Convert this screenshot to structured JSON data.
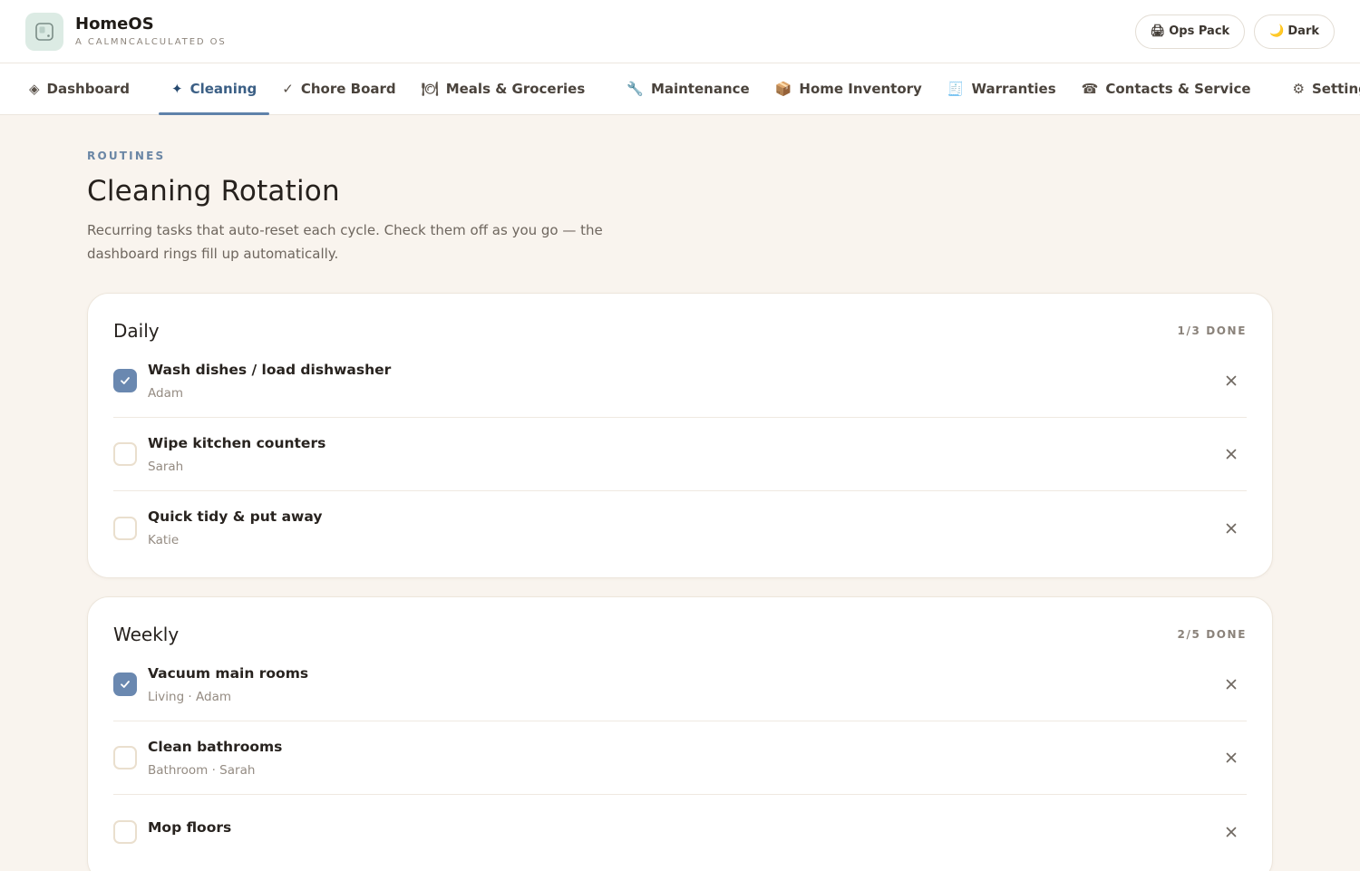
{
  "app": {
    "name": "HomeOS",
    "tagline": "A CALMNCALCULATED OS"
  },
  "top_actions": {
    "ops_pack": {
      "icon": "🖨",
      "label": "Ops Pack"
    },
    "dark": {
      "icon": "🌙",
      "label": "Dark"
    }
  },
  "nav": [
    {
      "icon": "◈",
      "label": "Dashboard"
    },
    {
      "icon": "✦",
      "label": "Cleaning"
    },
    {
      "icon": "✓",
      "label": "Chore Board"
    },
    {
      "icon": "🍽",
      "label": "Meals & Groceries"
    },
    {
      "icon": "🔧",
      "label": "Maintenance"
    },
    {
      "icon": "📦",
      "label": "Home Inventory"
    },
    {
      "icon": "🧾",
      "label": "Warranties"
    },
    {
      "icon": "☎",
      "label": "Contacts & Service"
    },
    {
      "icon": "⚙",
      "label": "Settings"
    }
  ],
  "page": {
    "eyebrow": "ROUTINES",
    "title": "Cleaning Rotation",
    "subtitle": "Recurring tasks that auto-reset each cycle. Check them off as you go — the dashboard rings fill up automatically."
  },
  "sections": [
    {
      "title": "Daily",
      "count": "1/3 DONE",
      "tasks": [
        {
          "name": "Wash dishes / load dishwasher",
          "meta": "Adam",
          "done": true
        },
        {
          "name": "Wipe kitchen counters",
          "meta": "Sarah",
          "done": false
        },
        {
          "name": "Quick tidy & put away",
          "meta": "Katie",
          "done": false
        }
      ]
    },
    {
      "title": "Weekly",
      "count": "2/5 DONE",
      "tasks": [
        {
          "name": "Vacuum main rooms",
          "meta": "Living · Adam",
          "done": true
        },
        {
          "name": "Clean bathrooms",
          "meta": "Bathroom · Sarah",
          "done": false
        },
        {
          "name": "Mop floors",
          "meta": "",
          "done": false
        }
      ]
    }
  ],
  "colors": {
    "accent": "#5f82aa",
    "checked": "#6a88b0",
    "background": "#f9f4ee"
  }
}
